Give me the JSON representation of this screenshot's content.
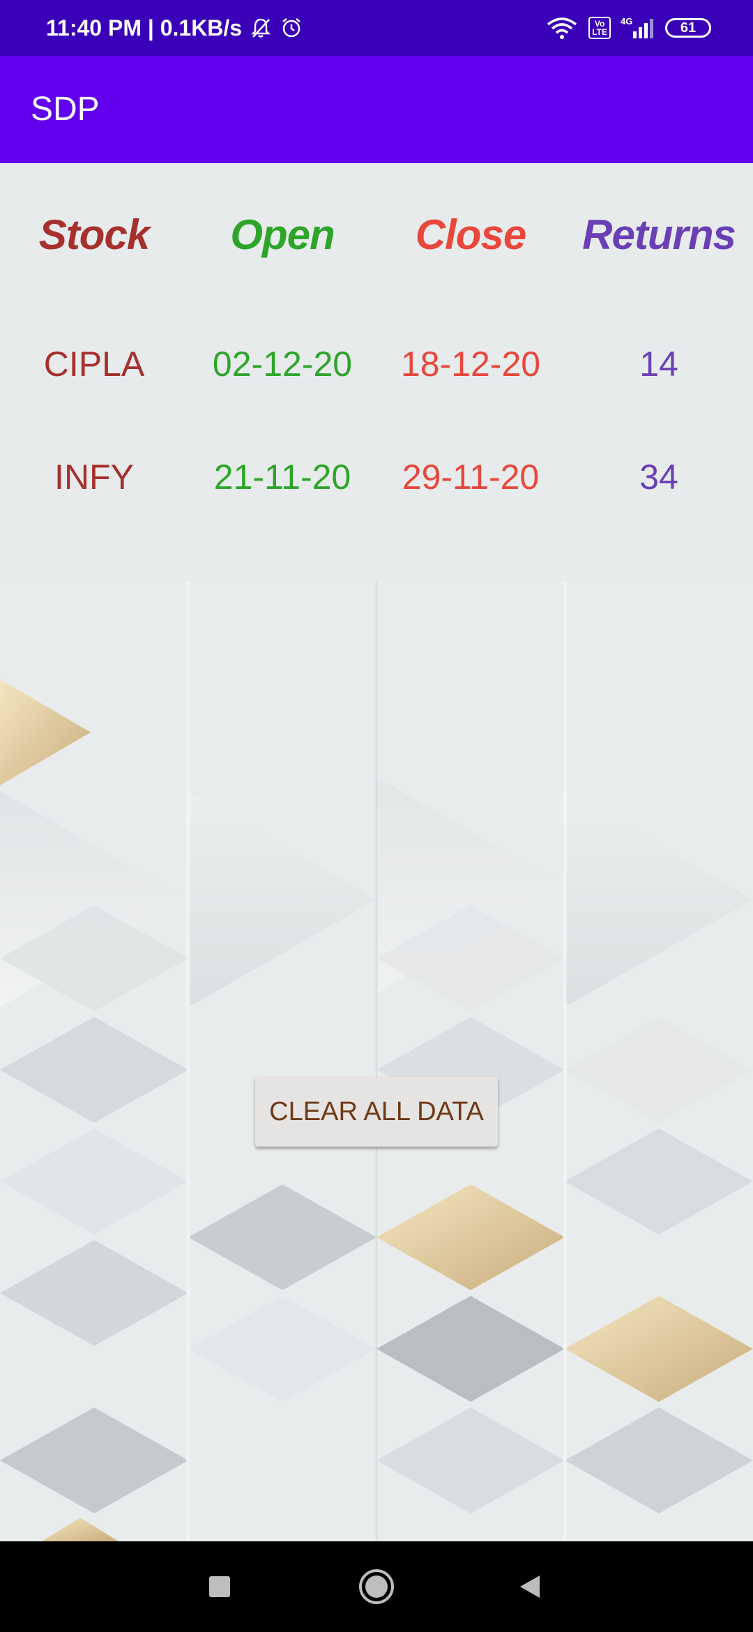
{
  "status_bar": {
    "time_speed": "11:40 PM | 0.1KB/s",
    "battery": "61",
    "network": "4G",
    "volte": "Vo\nLTE"
  },
  "app_bar": {
    "title": "SDP"
  },
  "colors": {
    "stock": "#a5302c",
    "open": "#2ea52a",
    "close": "#e8473c",
    "returns": "#6a3fb6",
    "app_bar": "#6200ee",
    "status_bar": "#3a00b7"
  },
  "table": {
    "headers": [
      "Stock",
      "Open",
      "Close",
      "Returns"
    ],
    "rows": [
      {
        "stock": "CIPLA",
        "open": "02-12-20",
        "close": "18-12-20",
        "returns": "14"
      },
      {
        "stock": "INFY",
        "open": "21-11-20",
        "close": "29-11-20",
        "returns": "34"
      }
    ]
  },
  "actions": {
    "clear_all": "CLEAR ALL DATA"
  },
  "nav": {
    "recent": "square-icon",
    "home": "circle-icon",
    "back": "triangle-back-icon"
  }
}
